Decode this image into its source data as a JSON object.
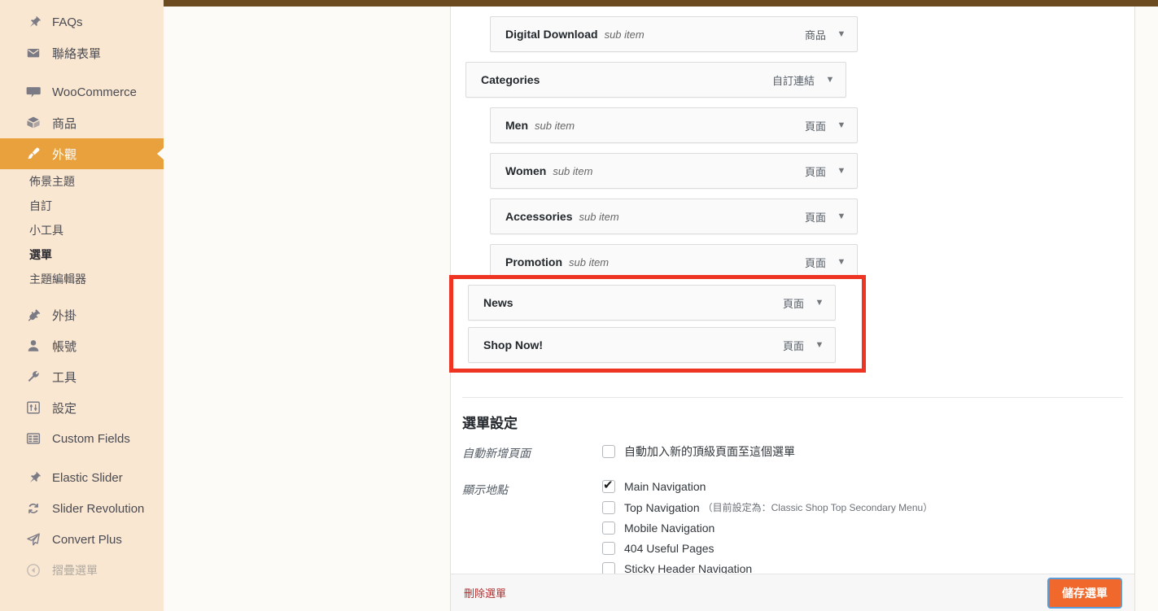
{
  "sidebar": {
    "items": [
      {
        "label": "FAQs",
        "icon": "pin-icon",
        "type": "item"
      },
      {
        "label": "聯絡表單",
        "icon": "envelope-icon",
        "type": "item"
      },
      {
        "label": "",
        "icon": "",
        "type": "gap"
      },
      {
        "label": "WooCommerce",
        "icon": "woo-icon",
        "type": "item"
      },
      {
        "label": "商品",
        "icon": "box-icon",
        "type": "item"
      },
      {
        "label": "外觀",
        "icon": "brush-icon",
        "type": "current"
      },
      {
        "label": "佈景主題",
        "type": "sub"
      },
      {
        "label": "自訂",
        "type": "sub"
      },
      {
        "label": "小工具",
        "type": "sub"
      },
      {
        "label": "選單",
        "type": "sub-active"
      },
      {
        "label": "主題編輯器",
        "type": "sub"
      },
      {
        "label": "",
        "icon": "",
        "type": "gap"
      },
      {
        "label": "外掛",
        "icon": "plug-icon",
        "type": "item"
      },
      {
        "label": "帳號",
        "icon": "user-icon",
        "type": "item"
      },
      {
        "label": "工具",
        "icon": "wrench-icon",
        "type": "item"
      },
      {
        "label": "設定",
        "icon": "sliders-icon",
        "type": "item"
      },
      {
        "label": "Custom Fields",
        "icon": "fields-icon",
        "type": "item"
      },
      {
        "label": "",
        "icon": "",
        "type": "gap"
      },
      {
        "label": "Elastic Slider",
        "icon": "pin-icon",
        "type": "item"
      },
      {
        "label": "Slider Revolution",
        "icon": "refresh-icon",
        "type": "item"
      },
      {
        "label": "Convert Plus",
        "icon": "paper-plane-icon",
        "type": "item"
      },
      {
        "label": "摺疊選單",
        "icon": "collapse-arrow-icon",
        "type": "collapse"
      }
    ]
  },
  "menu_items": [
    {
      "title": "Digital Download",
      "sub_label": "sub item",
      "type_label": "商品",
      "depth": 1
    },
    {
      "title": "Categories",
      "sub_label": "",
      "type_label": "自訂連結",
      "depth": 0
    },
    {
      "title": "Men",
      "sub_label": "sub item",
      "type_label": "頁面",
      "depth": 1
    },
    {
      "title": "Women",
      "sub_label": "sub item",
      "type_label": "頁面",
      "depth": 1
    },
    {
      "title": "Accessories",
      "sub_label": "sub item",
      "type_label": "頁面",
      "depth": 1
    },
    {
      "title": "Promotion",
      "sub_label": "sub item",
      "type_label": "頁面",
      "depth": 1
    }
  ],
  "highlighted_items": [
    {
      "title": "News",
      "sub_label": "",
      "type_label": "頁面"
    },
    {
      "title": "Shop Now!",
      "sub_label": "",
      "type_label": "頁面"
    }
  ],
  "settings": {
    "heading": "選單設定",
    "auto_add_label": "自動新增頁面",
    "auto_add_option": "自動加入新的頂級頁面至這個選單",
    "auto_add_checked": false,
    "display_location_label": "顯示地點",
    "locations": [
      {
        "label": "Main Navigation",
        "note": "",
        "checked": true
      },
      {
        "label": "Top Navigation",
        "note": "（目前設定為：Classic Shop Top Secondary Menu）",
        "checked": false
      },
      {
        "label": "Mobile Navigation",
        "note": "",
        "checked": false
      },
      {
        "label": "404 Useful Pages",
        "note": "",
        "checked": false
      },
      {
        "label": "Sticky Header Navigation",
        "note": "",
        "checked": false
      }
    ]
  },
  "footer": {
    "delete_label": "刪除選單",
    "save_label": "儲存選單"
  },
  "colors": {
    "topbar": "#6d4b21",
    "sidebar_bg": "#f9e7d2",
    "sidebar_current": "#e8a13c",
    "page_bg": "#fdfbf7",
    "highlight_red": "#ee3524",
    "save_button": "#f0682b",
    "delete_link": "#b32d2e"
  },
  "icons": {
    "dropdown_arrow": "▼"
  }
}
